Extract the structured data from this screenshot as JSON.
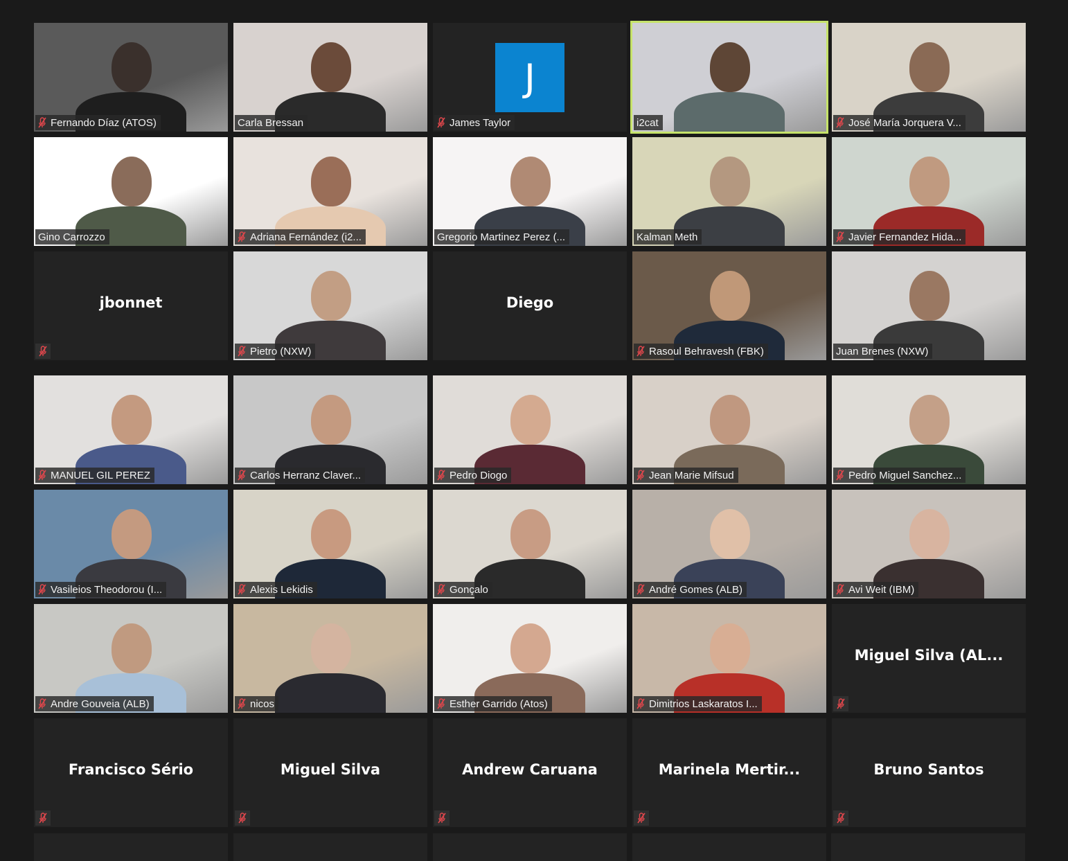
{
  "app": "video-conference-gallery-view",
  "colors": {
    "background": "#1a1a1a",
    "tile": "#232323",
    "active_speaker_border": "#c6e36a",
    "muted_icon": "#e0474c",
    "avatar_bg": "#0b84d0"
  },
  "page_top": [
    {
      "name": "Fernando Díaz (ATOS)",
      "muted": true,
      "video": true
    },
    {
      "name": "Carla Bressan",
      "muted": false,
      "video": true
    },
    {
      "name": "James Taylor",
      "muted": true,
      "video": false,
      "avatar_letter": "J"
    },
    {
      "name": "i2cat",
      "muted": false,
      "video": true,
      "active_speaker": true
    },
    {
      "name": "José María Jorquera V...",
      "muted": true,
      "video": true
    },
    {
      "name": "Gino Carrozzo",
      "muted": false,
      "video": true
    },
    {
      "name": "Adriana Fernández (i2...",
      "muted": true,
      "video": true
    },
    {
      "name": "Gregorio Martinez Perez (...",
      "muted": false,
      "video": true
    },
    {
      "name": "Kalman Meth",
      "muted": false,
      "video": true
    },
    {
      "name": "Javier Fernandez Hida...",
      "muted": true,
      "video": true
    },
    {
      "name": "jbonnet",
      "muted": true,
      "video": false
    },
    {
      "name": "Pietro (NXW)",
      "muted": true,
      "video": true
    },
    {
      "name": "Diego",
      "muted": false,
      "video": false
    },
    {
      "name": "Rasoul Behravesh (FBK)",
      "muted": true,
      "video": true
    },
    {
      "name": "Juan Brenes (NXW)",
      "muted": false,
      "video": true
    }
  ],
  "page_bottom": [
    {
      "name": "MANUEL GIL PEREZ",
      "muted": true,
      "video": true
    },
    {
      "name": "Carlos Herranz Claver...",
      "muted": true,
      "video": true
    },
    {
      "name": "Pedro Diogo",
      "muted": true,
      "video": true
    },
    {
      "name": "Jean Marie Mifsud",
      "muted": true,
      "video": true
    },
    {
      "name": "Pedro Miguel Sanchez...",
      "muted": true,
      "video": true
    },
    {
      "name": "Vasileios Theodorou (I...",
      "muted": true,
      "video": true
    },
    {
      "name": "Alexis Lekidis",
      "muted": true,
      "video": true
    },
    {
      "name": "Gonçalo",
      "muted": true,
      "video": true
    },
    {
      "name": "André Gomes (ALB)",
      "muted": true,
      "video": true
    },
    {
      "name": "Avi Weit (IBM)",
      "muted": true,
      "video": true
    },
    {
      "name": "Andre Gouveia (ALB)",
      "muted": true,
      "video": true
    },
    {
      "name": "nicos",
      "muted": true,
      "video": true
    },
    {
      "name": "Esther Garrido (Atos)",
      "muted": true,
      "video": true
    },
    {
      "name": "Dimitrios Laskaratos I...",
      "muted": true,
      "video": true
    },
    {
      "name": "Miguel  Silva  (AL...",
      "muted": true,
      "video": false
    },
    {
      "name": "Francisco Sério",
      "muted": true,
      "video": false
    },
    {
      "name": "Miguel Silva",
      "muted": true,
      "video": false
    },
    {
      "name": "Andrew Caruana",
      "muted": true,
      "video": false
    },
    {
      "name": "Marinela  Mertir...",
      "muted": true,
      "video": false
    },
    {
      "name": "Bruno Santos",
      "muted": true,
      "video": false
    }
  ]
}
